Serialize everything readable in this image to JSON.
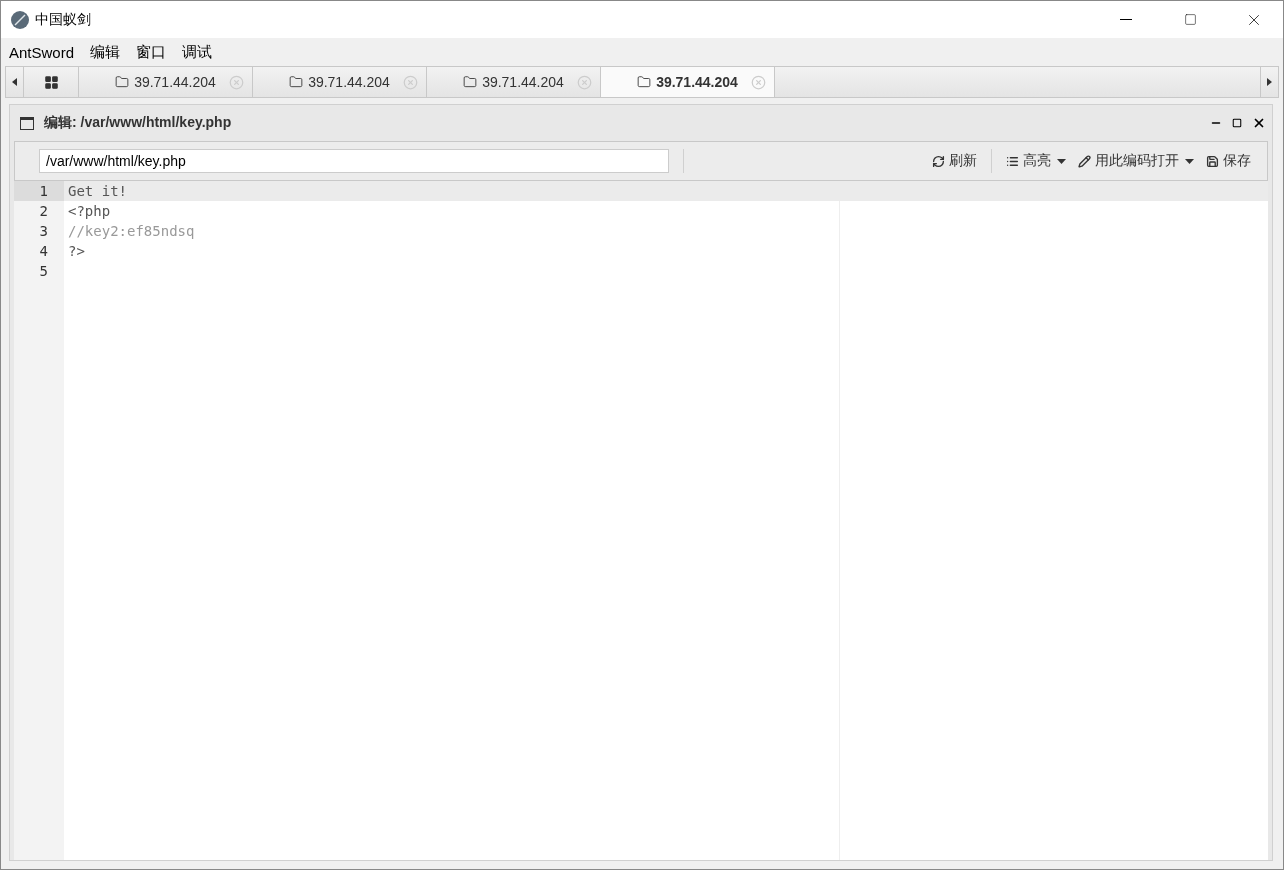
{
  "window": {
    "title": "中国蚁剑"
  },
  "menu": [
    "AntSword",
    "编辑",
    "窗口",
    "调试"
  ],
  "tabs": [
    {
      "label": "39.71.44.204",
      "selected": false
    },
    {
      "label": "39.71.44.204",
      "selected": false
    },
    {
      "label": "39.71.44.204",
      "selected": false
    },
    {
      "label": "39.71.44.204",
      "selected": true
    }
  ],
  "panel": {
    "title": "编辑: /var/www/html/key.php"
  },
  "path_field": {
    "value": "/var/www/html/key.php"
  },
  "toolbar": [
    {
      "kind": "refresh",
      "label": "刷新",
      "dropdown": false
    },
    {
      "kind": "highlight",
      "label": "高亮",
      "dropdown": true
    },
    {
      "kind": "encoding",
      "label": "用此编码打开",
      "dropdown": true
    },
    {
      "kind": "save",
      "label": "保存",
      "dropdown": false
    }
  ],
  "editor": {
    "lines": [
      {
        "number": "1",
        "text": "Get it!",
        "kind": "text",
        "selected": true
      },
      {
        "number": "2",
        "text": "<?php",
        "kind": "text",
        "selected": false
      },
      {
        "number": "3",
        "text": "//key2:ef85ndsq",
        "kind": "comment",
        "selected": false
      },
      {
        "number": "4",
        "text": "?>",
        "kind": "text",
        "selected": false
      },
      {
        "number": "5",
        "kind": "text",
        "selected": false
      }
    ]
  }
}
